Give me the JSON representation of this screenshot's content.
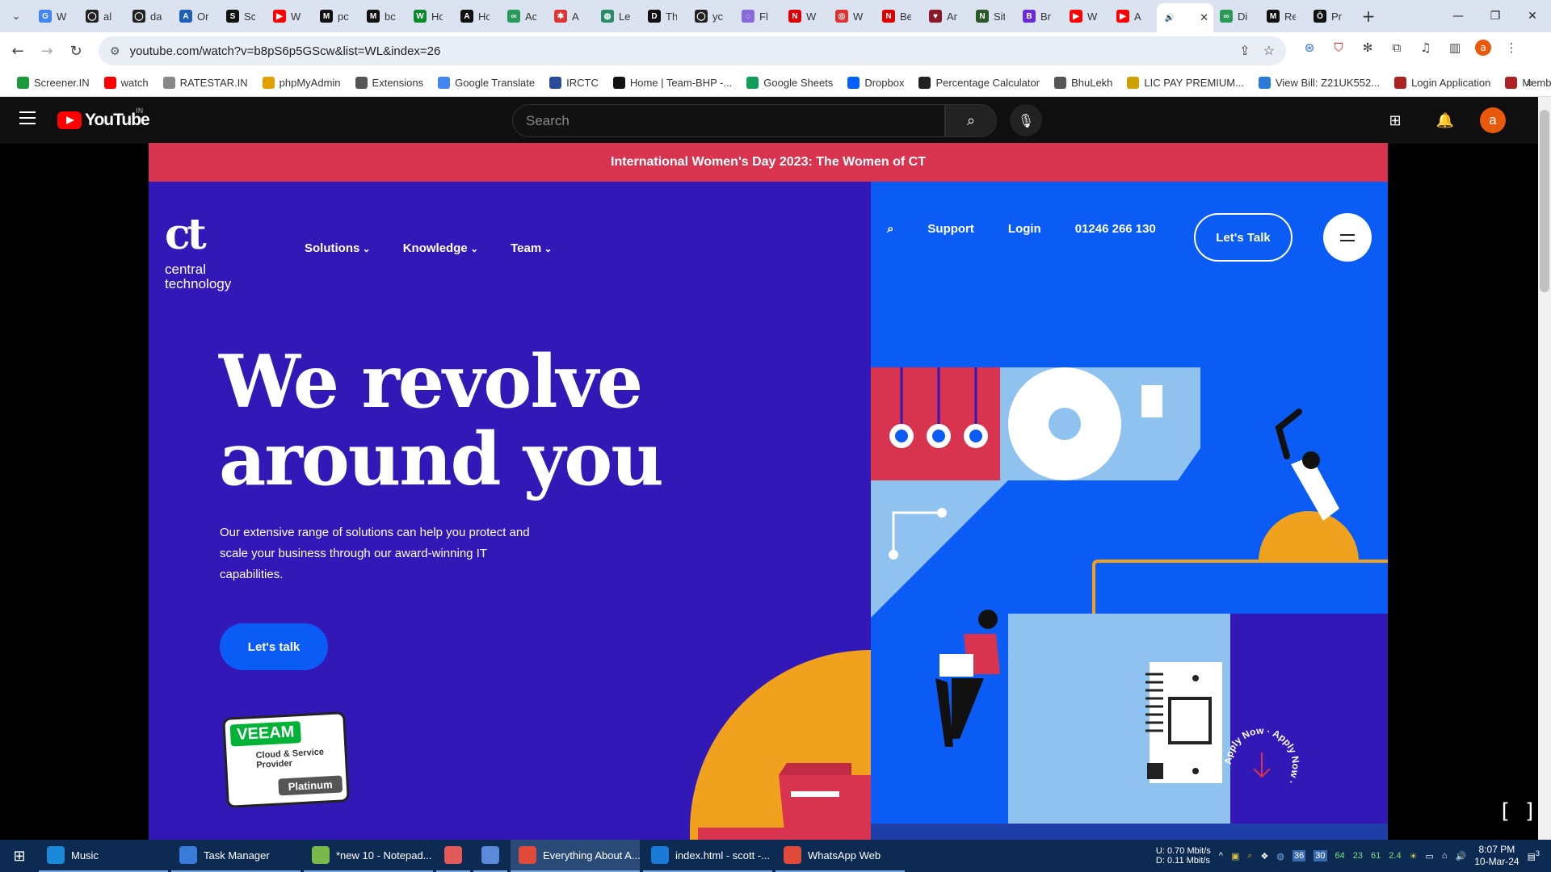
{
  "browser": {
    "tabs": [
      {
        "letter": "G",
        "title": "W",
        "color": "#4285f4"
      },
      {
        "letter": "◯",
        "title": "al",
        "color": "#222"
      },
      {
        "letter": "◯",
        "title": "da",
        "color": "#222"
      },
      {
        "letter": "A",
        "title": "Or",
        "color": "#1e5fb8"
      },
      {
        "letter": "S",
        "title": "Sc",
        "color": "#111"
      },
      {
        "letter": "▶",
        "title": "W",
        "color": "#ff0000"
      },
      {
        "letter": "M",
        "title": "pc",
        "color": "#111"
      },
      {
        "letter": "M",
        "title": "bc",
        "color": "#111"
      },
      {
        "letter": "W",
        "title": "Hc",
        "color": "#0a8a2a"
      },
      {
        "letter": "A",
        "title": "Hc",
        "color": "#111"
      },
      {
        "letter": "∞",
        "title": "Ac",
        "color": "#2a9a5a"
      },
      {
        "letter": "✱",
        "title": "A",
        "color": "#d33"
      },
      {
        "letter": "◍",
        "title": "Le",
        "color": "#2a8a6a"
      },
      {
        "letter": "D",
        "title": "Th",
        "color": "#111"
      },
      {
        "letter": "◯",
        "title": "yc",
        "color": "#222"
      },
      {
        "letter": "◌",
        "title": "Fl",
        "color": "#8a6ad8"
      },
      {
        "letter": "N",
        "title": "W",
        "color": "#d00"
      },
      {
        "letter": "◎",
        "title": "W",
        "color": "#d33"
      },
      {
        "letter": "N",
        "title": "Be",
        "color": "#d00"
      },
      {
        "letter": "♥",
        "title": "Ar",
        "color": "#8a1a2a"
      },
      {
        "letter": "N",
        "title": "Sit",
        "color": "#2a5a2a"
      },
      {
        "letter": "B",
        "title": "Br",
        "color": "#6a2ad8"
      },
      {
        "letter": "▶",
        "title": "W",
        "color": "#ff0000"
      },
      {
        "letter": "▶",
        "title": "A",
        "color": "#ff0000"
      },
      {
        "letter": "🔊",
        "title": "",
        "color": "#fff"
      },
      {
        "letter": "∞",
        "title": "Di",
        "color": "#2a9a5a"
      },
      {
        "letter": "M",
        "title": "Re",
        "color": "#111"
      },
      {
        "letter": "Ō",
        "title": "Pr",
        "color": "#111"
      }
    ],
    "active_tab_index": 24,
    "url": "youtube.com/watch?v=b8pS6p5GScw&list=WL&index=26",
    "bookmarks": [
      {
        "label": "Screener.IN",
        "color": "#1a9a3a"
      },
      {
        "label": "watch",
        "color": "#ff0000"
      },
      {
        "label": "RATESTAR.IN",
        "color": "#888"
      },
      {
        "label": "phpMyAdmin",
        "color": "#e0a000"
      },
      {
        "label": "Extensions",
        "color": "#555"
      },
      {
        "label": "Google Translate",
        "color": "#4285f4"
      },
      {
        "label": "IRCTC",
        "color": "#2a4a9a"
      },
      {
        "label": "Home | Team-BHP -...",
        "color": "#111"
      },
      {
        "label": "Google Sheets",
        "color": "#0f9d58"
      },
      {
        "label": "Dropbox",
        "color": "#0061fe"
      },
      {
        "label": "Percentage Calculator",
        "color": "#222"
      },
      {
        "label": "BhuLekh",
        "color": "#555"
      },
      {
        "label": "LIC PAY PREMIUM...",
        "color": "#d0a000"
      },
      {
        "label": "View Bill: Z21UK552...",
        "color": "#2a7ad8"
      },
      {
        "label": "Login Application",
        "color": "#a22"
      },
      {
        "label": "Member Home",
        "color": "#a22"
      }
    ]
  },
  "youtube": {
    "logo_text": "YouTube",
    "region": "IN",
    "search_placeholder": "Search",
    "avatar_letter": "a"
  },
  "video": {
    "banner": "International Women's Day 2023: The Women of CT",
    "logo_mark": "ct",
    "logo_line1": "central",
    "logo_line2": "technology",
    "nav": [
      "Solutions",
      "Knowledge",
      "Team"
    ],
    "right_nav": [
      "Support",
      "Login",
      "01246 266 130"
    ],
    "lets_talk_nav": "Let's Talk",
    "hero_line1": "We revolve",
    "hero_line2": "around you",
    "subtext": "Our extensive range of solutions can help you protect and scale your business through our award-winning IT capabilities.",
    "cta": "Let's talk",
    "badge_brand": "VEEAM",
    "badge_line1": "Cloud & Service",
    "badge_line2": "Provider",
    "badge_tier": "Platinum",
    "apply_text": "Apply Now · Apply Now · "
  },
  "taskbar": {
    "items": [
      {
        "label": "Music",
        "color": "#1a8ad8"
      },
      {
        "label": "Task Manager",
        "color": "#3a7ad8"
      },
      {
        "label": "*new 10 - Notepad...",
        "color": "#7ab84a"
      },
      {
        "label": "",
        "color": "#e05a5a"
      },
      {
        "label": "",
        "color": "#5a8ad8"
      },
      {
        "label": "Everything About A...",
        "color": "#e04a3a"
      },
      {
        "label": "index.html - scott -...",
        "color": "#1a7ad8"
      },
      {
        "label": "WhatsApp Web",
        "color": "#e04a3a"
      }
    ],
    "active_index": 5,
    "net_up": "0.70 Mbit/s",
    "net_down": "0.11 Mbit/s",
    "net_u_label": "U:",
    "net_d_label": "D:",
    "tray_numbers": [
      "36",
      "30",
      "64",
      "23",
      "61",
      "2.4"
    ],
    "time": "8:07 PM",
    "date": "10-Mar-24",
    "notif_count": "3"
  }
}
